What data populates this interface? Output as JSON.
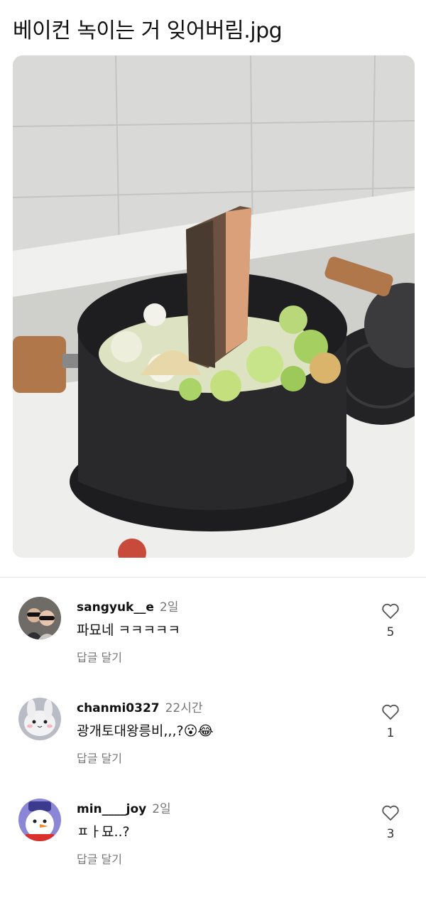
{
  "post": {
    "title": "베이컨 녹이는 거 잊어버림.jpg"
  },
  "comments": [
    {
      "username": "sangyuk__e",
      "time": "2일",
      "text": "파묘네 ㅋㅋㅋㅋㅋ",
      "reply_label": "답글 달기",
      "likes": "5",
      "avatar_icon": "couple-photo-avatar"
    },
    {
      "username": "chanmi0327",
      "time": "22시간",
      "text": "광개토대왕릉비,,,?😮😂",
      "reply_label": "답글 달기",
      "likes": "1",
      "avatar_icon": "bunny-character-avatar"
    },
    {
      "username": "min____joy",
      "time": "2일",
      "text": "ㅍㅏ묘..?",
      "reply_label": "답글 달기",
      "likes": "3",
      "avatar_icon": "snowman-avatar"
    }
  ],
  "colors": {
    "muted_text": "#777777",
    "divider": "#e5e5e5"
  }
}
